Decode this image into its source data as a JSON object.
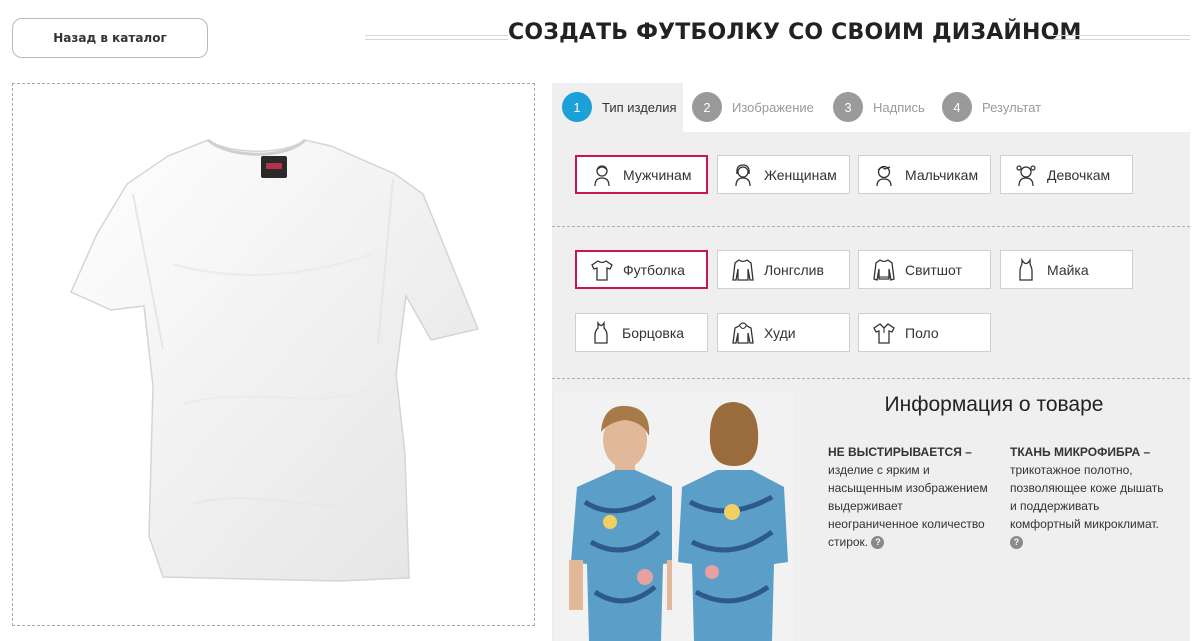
{
  "header": {
    "back_label": "Назад в каталог",
    "title": "СОЗДАТЬ ФУТБОЛКУ СО СВОИМ ДИЗАЙНОМ"
  },
  "steps": [
    {
      "num": "1",
      "label": "Тип изделия",
      "active": true
    },
    {
      "num": "2",
      "label": "Изображение",
      "active": false
    },
    {
      "num": "3",
      "label": "Надпись",
      "active": false
    },
    {
      "num": "4",
      "label": "Результат",
      "active": false
    }
  ],
  "audience": [
    {
      "label": "Мужчинам",
      "icon": "man-icon",
      "selected": true
    },
    {
      "label": "Женщинам",
      "icon": "woman-icon",
      "selected": false
    },
    {
      "label": "Мальчикам",
      "icon": "boy-icon",
      "selected": false
    },
    {
      "label": "Девочкам",
      "icon": "girl-icon",
      "selected": false
    }
  ],
  "products": [
    {
      "label": "Футболка",
      "icon": "tshirt-icon",
      "selected": true
    },
    {
      "label": "Лонгслив",
      "icon": "longsleeve-icon",
      "selected": false
    },
    {
      "label": "Свитшот",
      "icon": "sweatshirt-icon",
      "selected": false
    },
    {
      "label": "Майка",
      "icon": "tanktop-icon",
      "selected": false
    },
    {
      "label": "Борцовка",
      "icon": "racerback-icon",
      "selected": false
    },
    {
      "label": "Худи",
      "icon": "hoodie-icon",
      "selected": false
    },
    {
      "label": "Поло",
      "icon": "polo-icon",
      "selected": false
    }
  ],
  "info": {
    "title": "Информация о товаре",
    "col1_heading": "НЕ ВЫСТИРЫВАЕТСЯ –",
    "col1_text": "изделие с ярким и насыщенным изображением выдерживает неограниченное количество стирок.",
    "col2_heading": "ТКАНЬ МИКРОФИБРА –",
    "col2_text": "трикотажное полотно, позволяющее коже дышать и поддерживать комфортный микроклимат.",
    "help_glyph": "?"
  },
  "colors": {
    "accent_step": "#1ba0d8",
    "selected_border": "#c8174a",
    "panel_bg": "#efefef"
  }
}
